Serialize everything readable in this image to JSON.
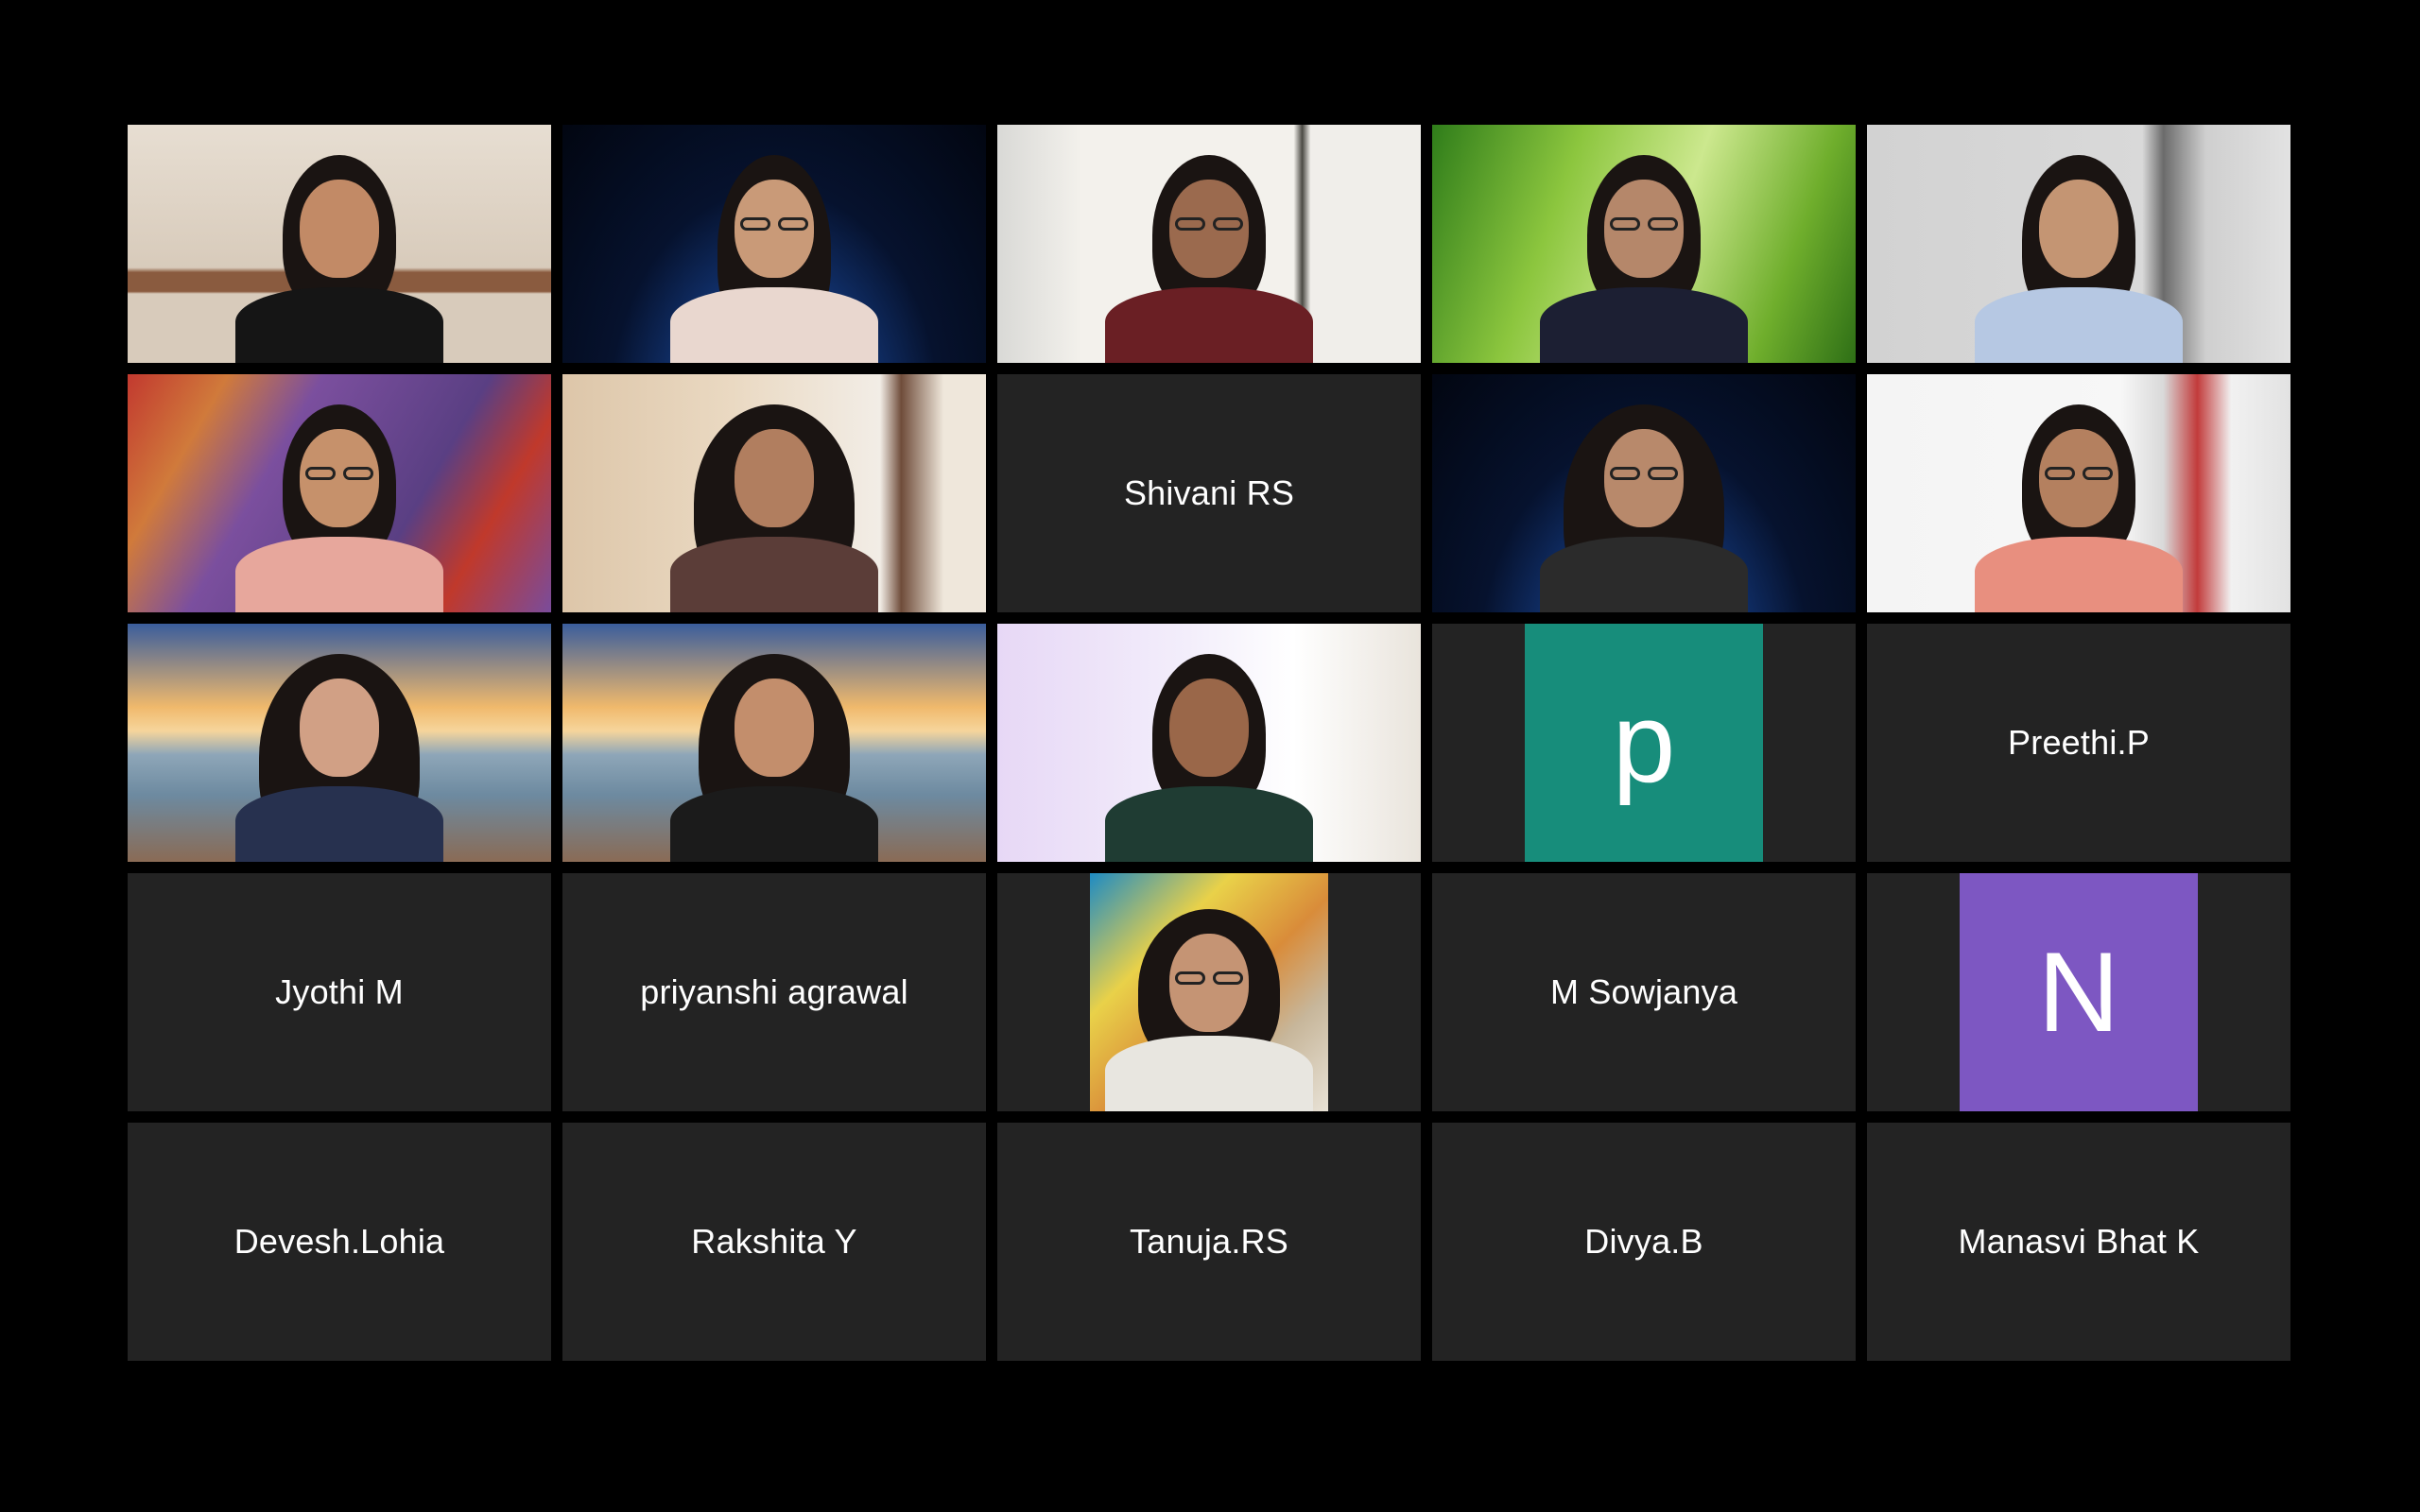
{
  "meeting": {
    "layout": "gallery-5x5",
    "participants": [
      {
        "type": "video",
        "scene": "living-room",
        "bg": "#d9cfc2"
      },
      {
        "type": "video",
        "scene": "space-earth",
        "bg": "#0b1a3a"
      },
      {
        "type": "video",
        "scene": "room-plants",
        "bg": "#eceae6"
      },
      {
        "type": "video",
        "scene": "grass",
        "bg": "#7fbf3a"
      },
      {
        "type": "video",
        "scene": "plain-room",
        "bg": "#cfcfcf"
      },
      {
        "type": "video",
        "scene": "painted-wall",
        "bg": "#7a4c9b"
      },
      {
        "type": "video",
        "scene": "beige-wall",
        "bg": "#e8dcc9"
      },
      {
        "type": "name",
        "name": "Shivani RS"
      },
      {
        "type": "video",
        "scene": "space-earth",
        "bg": "#0c1a3b"
      },
      {
        "type": "video",
        "scene": "target-wall",
        "bg": "#e9e9e9"
      },
      {
        "type": "video",
        "scene": "golden-gate",
        "bg": "#7c8fb0"
      },
      {
        "type": "video",
        "scene": "golden-gate",
        "bg": "#7c8fb0"
      },
      {
        "type": "video",
        "scene": "lavender-room",
        "bg": "#efe9f6"
      },
      {
        "type": "avatar",
        "letter": "p",
        "color": "#178d7b"
      },
      {
        "type": "name",
        "name": "Preethi.P"
      },
      {
        "type": "name",
        "name": "Jyothi M"
      },
      {
        "type": "name",
        "name": "priyanshi agrawal"
      },
      {
        "type": "photo",
        "scene": "reading-photo",
        "bg": "#cfc2a8"
      },
      {
        "type": "name",
        "name": "M Sowjanya"
      },
      {
        "type": "avatar",
        "letter": "N",
        "color": "#7d57c2"
      },
      {
        "type": "name",
        "name": "Devesh.Lohia"
      },
      {
        "type": "name",
        "name": "Rakshita Y"
      },
      {
        "type": "name",
        "name": "Tanuja.RS"
      },
      {
        "type": "name",
        "name": "Divya.B"
      },
      {
        "type": "name",
        "name": "Manasvi Bhat K"
      }
    ]
  },
  "colors": {
    "background": "#000000",
    "tile": "#232323",
    "text": "#ffffff"
  }
}
